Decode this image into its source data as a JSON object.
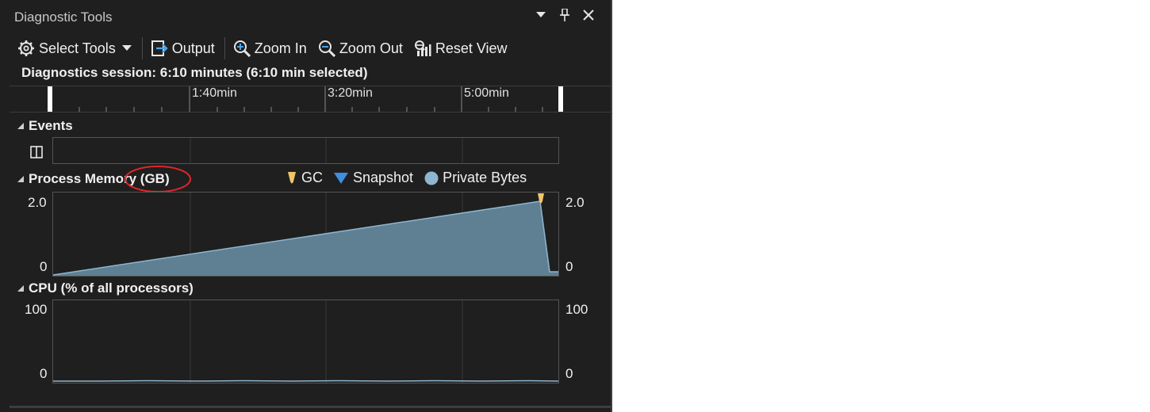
{
  "window": {
    "title": "Diagnostic Tools"
  },
  "toolbar": {
    "select_tools": "Select Tools",
    "output": "Output",
    "zoom_in": "Zoom In",
    "zoom_out": "Zoom Out",
    "reset_view": "Reset View"
  },
  "session": {
    "text": "Diagnostics session: 6:10 minutes (6:10 min selected)"
  },
  "ruler": {
    "ticks": [
      "1:40min",
      "3:20min",
      "5:00min"
    ]
  },
  "events": {
    "label": "Events"
  },
  "memory": {
    "label": "Process Memory (GB)",
    "y_max": "2.0",
    "y_min": "0",
    "legend": {
      "gc": "GC",
      "snapshot": "Snapshot",
      "private_bytes": "Private Bytes"
    },
    "colors": {
      "fill": "#5f7f93",
      "line": "#8db6d0",
      "gc": "#f2c46a",
      "snapshot": "#3e8ede",
      "annotation": "#e0252a"
    }
  },
  "cpu": {
    "label": "CPU (% of all processors)",
    "y_max": "100",
    "y_min": "0"
  }
}
